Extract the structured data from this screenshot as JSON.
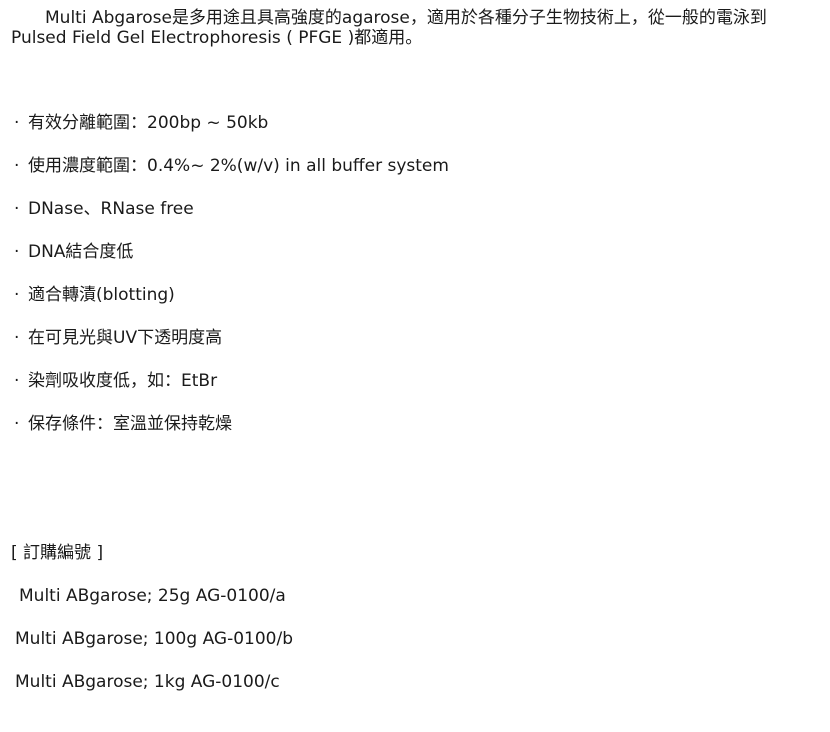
{
  "intro": {
    "line1": "Multi Abgarose是多用途且具高強度的agarose，適用於各種分子生物技術上，從一般的電泳到",
    "line2": "Pulsed Field Gel Electrophoresis ( PFGE )都適用。"
  },
  "bullet_symbol": "·",
  "features": [
    "有效分離範圍：200bp ~ 50kb",
    "使用濃度範圍：0.4%~ 2%(w/v) in all buffer system",
    "DNase、RNase free",
    "DNA結合度低",
    "適合轉漬(blotting)",
    "在可見光與UV下透明度高",
    "染劑吸收度低，如：EtBr",
    "保存條件：室溫並保持乾燥"
  ],
  "order": {
    "heading": "[ 訂購編號 ]",
    "items": [
      "Multi ABgarose; 25g AG-0100/a",
      "Multi ABgarose; 100g AG-0100/b",
      "Multi ABgarose; 1kg AG-0100/c"
    ]
  }
}
